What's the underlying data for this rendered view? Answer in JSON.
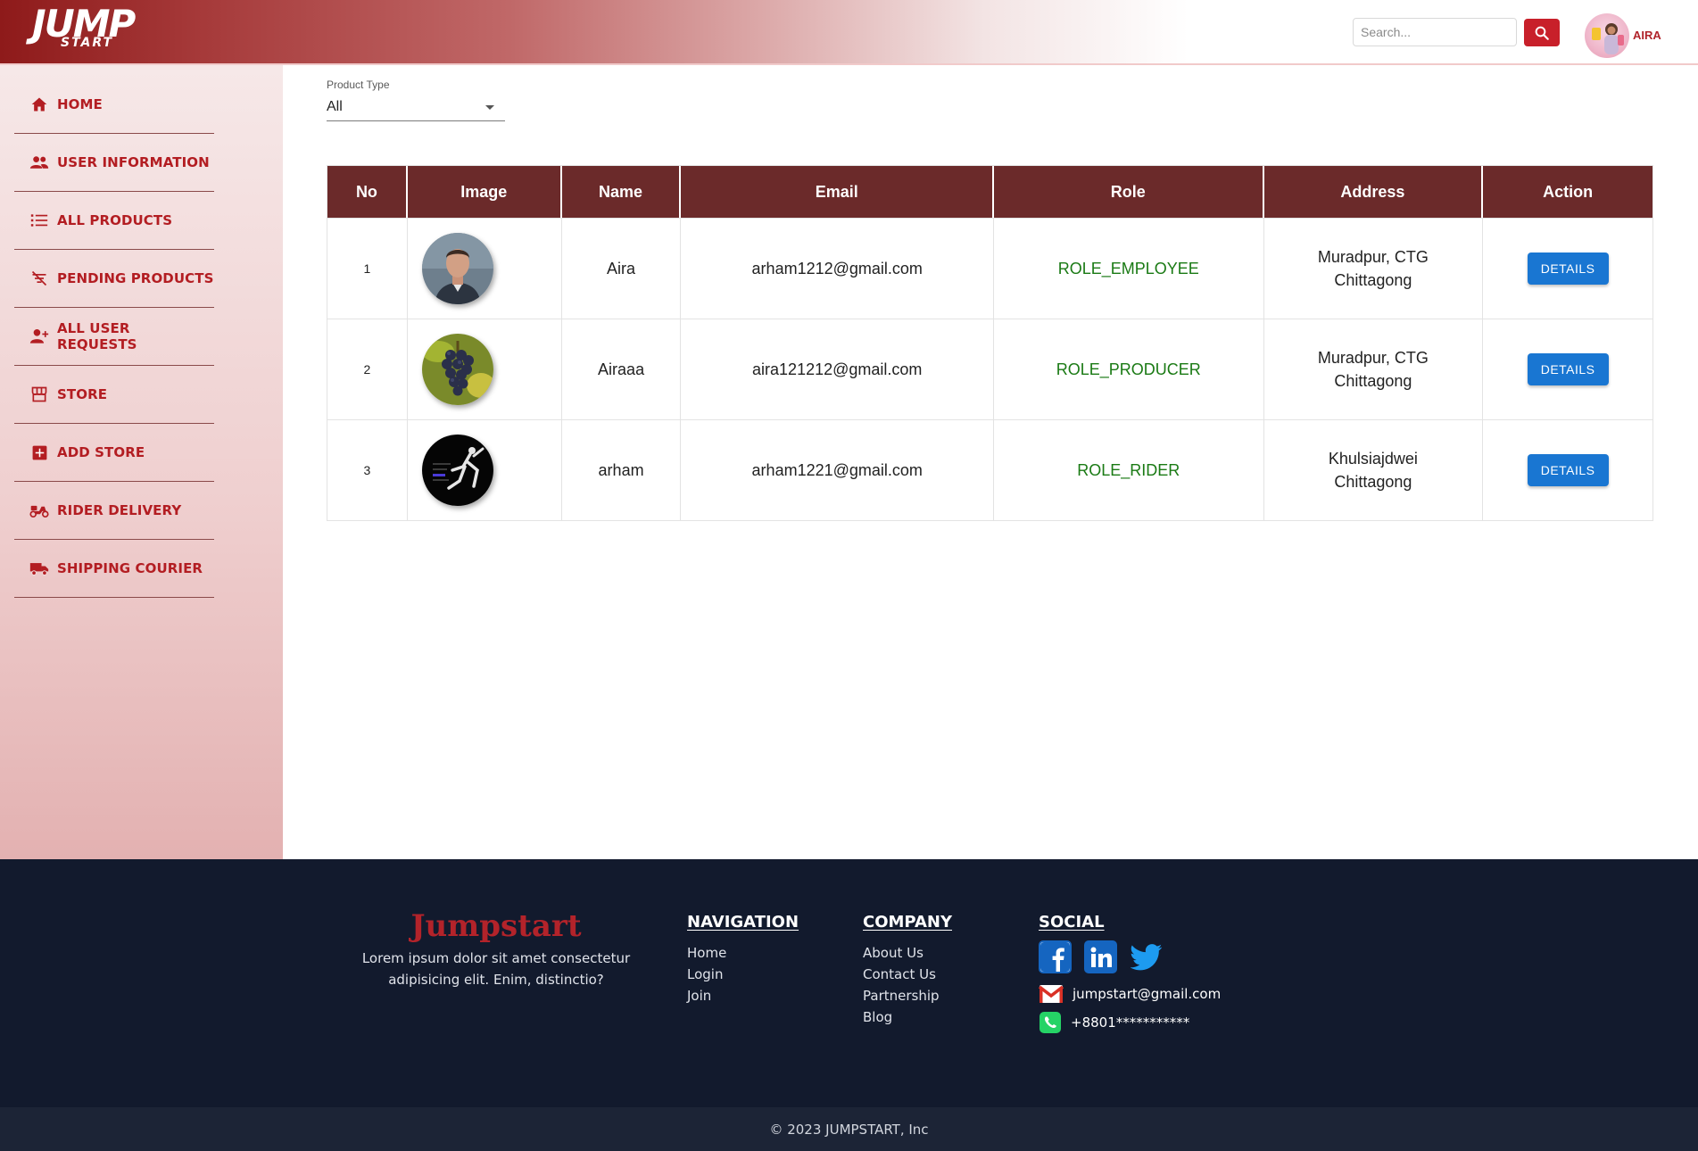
{
  "header": {
    "logo_main": "JUMP",
    "logo_sub": "START",
    "search_placeholder": "Search...",
    "user_name": "AIRA"
  },
  "sidebar": {
    "items": [
      {
        "label": "HOME",
        "icon": "home-icon"
      },
      {
        "label": "USER INFORMATION",
        "icon": "users-icon"
      },
      {
        "label": "ALL PRODUCTS",
        "icon": "list-icon"
      },
      {
        "label": "PENDING PRODUCTS",
        "icon": "filter-off-icon"
      },
      {
        "label": "ALL USER REQUESTS",
        "icon": "person-add-icon"
      },
      {
        "label": "STORE",
        "icon": "store-icon"
      },
      {
        "label": "ADD STORE",
        "icon": "add-box-icon"
      },
      {
        "label": "RIDER DELIVERY",
        "icon": "scooter-icon"
      },
      {
        "label": "SHIPPING COURIER",
        "icon": "truck-icon"
      }
    ]
  },
  "filter": {
    "label": "Product Type",
    "value": "All"
  },
  "table": {
    "headers": [
      "No",
      "Image",
      "Name",
      "Email",
      "Role",
      "Address",
      "Action"
    ],
    "rows": [
      {
        "no": "1",
        "image": "man-portrait",
        "name": "Aira",
        "email": "arham1212@gmail.com",
        "role": "ROLE_EMPLOYEE",
        "address_line1": "Muradpur, CTG",
        "address_line2": "Chittagong",
        "action": "DETAILS"
      },
      {
        "no": "2",
        "image": "grapes",
        "name": "Airaaa",
        "email": "aira121212@gmail.com",
        "role": "ROLE_PRODUCER",
        "address_line1": "Muradpur, CTG",
        "address_line2": "Chittagong",
        "action": "DETAILS"
      },
      {
        "no": "3",
        "image": "dark-figure",
        "name": "arham",
        "email": "arham1221@gmail.com",
        "role": "ROLE_RIDER",
        "address_line1": "Khulsiajdwei",
        "address_line2": "Chittagong",
        "action": "DETAILS"
      }
    ]
  },
  "footer": {
    "brand": "Jumpstart",
    "tagline": "Lorem ipsum dolor sit amet consectetur adipisicing elit. Enim, distinctio?",
    "navigation": {
      "title": "NAVIGATION",
      "links": [
        "Home",
        "Login",
        "Join"
      ]
    },
    "company": {
      "title": "COMPANY",
      "links": [
        "About Us",
        "Contact Us",
        "Partnership",
        "Blog"
      ]
    },
    "social": {
      "title": "SOCIAL",
      "email": "jumpstart@gmail.com",
      "phone": "+8801***********"
    },
    "copyright": "© 2023 JUMPSTART, Inc"
  },
  "colors": {
    "brand_red": "#b31d22",
    "table_header": "#6b2a2a",
    "role_green": "#1a7a14",
    "button_blue": "#1976d2",
    "footer_bg": "#121a2d"
  }
}
